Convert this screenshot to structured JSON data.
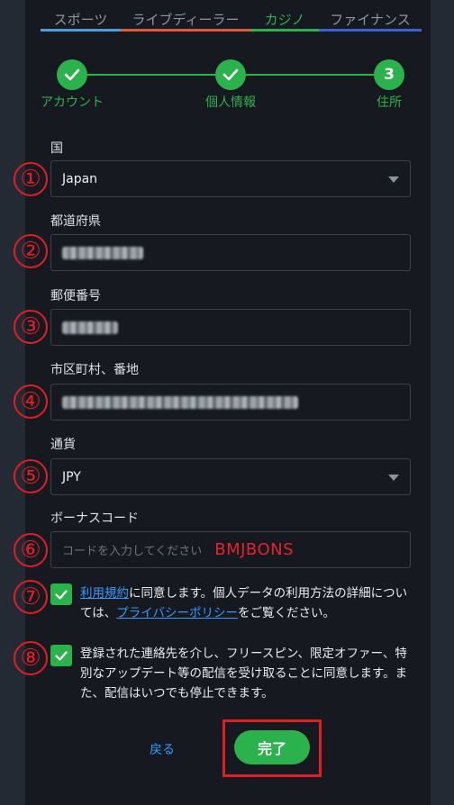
{
  "tabs": [
    {
      "label": "スポーツ",
      "color": "#4a9fe0"
    },
    {
      "label": "ライブディーラー",
      "color": "#e0573a"
    },
    {
      "label": "カジノ",
      "color": "#2bb24c",
      "active": true
    },
    {
      "label": "ファイナンス",
      "color": "#3d63d6"
    }
  ],
  "stepper": {
    "steps": [
      {
        "label": "アカウント",
        "state": "done",
        "icon": "check-icon"
      },
      {
        "label": "個人情報",
        "state": "done",
        "icon": "check-icon"
      },
      {
        "label": "住所",
        "state": "current",
        "number": "3"
      }
    ]
  },
  "form": {
    "country": {
      "label": "国",
      "value": "Japan"
    },
    "prefecture": {
      "label": "都道府県",
      "value": "[blurred]"
    },
    "postal_code": {
      "label": "郵便番号",
      "value": "[blurred]"
    },
    "address": {
      "label": "市区町村、番地",
      "value": "[blurred]"
    },
    "currency": {
      "label": "通貨",
      "value": "JPY"
    },
    "bonus_code": {
      "label": "ボーナスコード",
      "placeholder": "コードを入力してください",
      "annotation": "BMJBONS"
    }
  },
  "consent": {
    "terms_link": "利用規約",
    "terms_text_1": "に同意します。個人データの利用方法の詳細については、",
    "privacy_link": "プライバシーポリシー",
    "terms_text_2": "をご覧ください。",
    "marketing_text": "登録された連絡先を介し、フリースピン、限定オファー、特別なアップデート等の配信を受け取ることに同意します。また、配信はいつでも停止できます。"
  },
  "actions": {
    "back_label": "戻る",
    "finish_label": "完了"
  },
  "annotations": [
    "①",
    "②",
    "③",
    "④",
    "⑤",
    "⑥",
    "⑦",
    "⑧"
  ],
  "colors": {
    "accent_green": "#2bb24c",
    "annotation_red": "#e01e24",
    "link_blue": "#2f9bff",
    "background": "#161a20"
  }
}
